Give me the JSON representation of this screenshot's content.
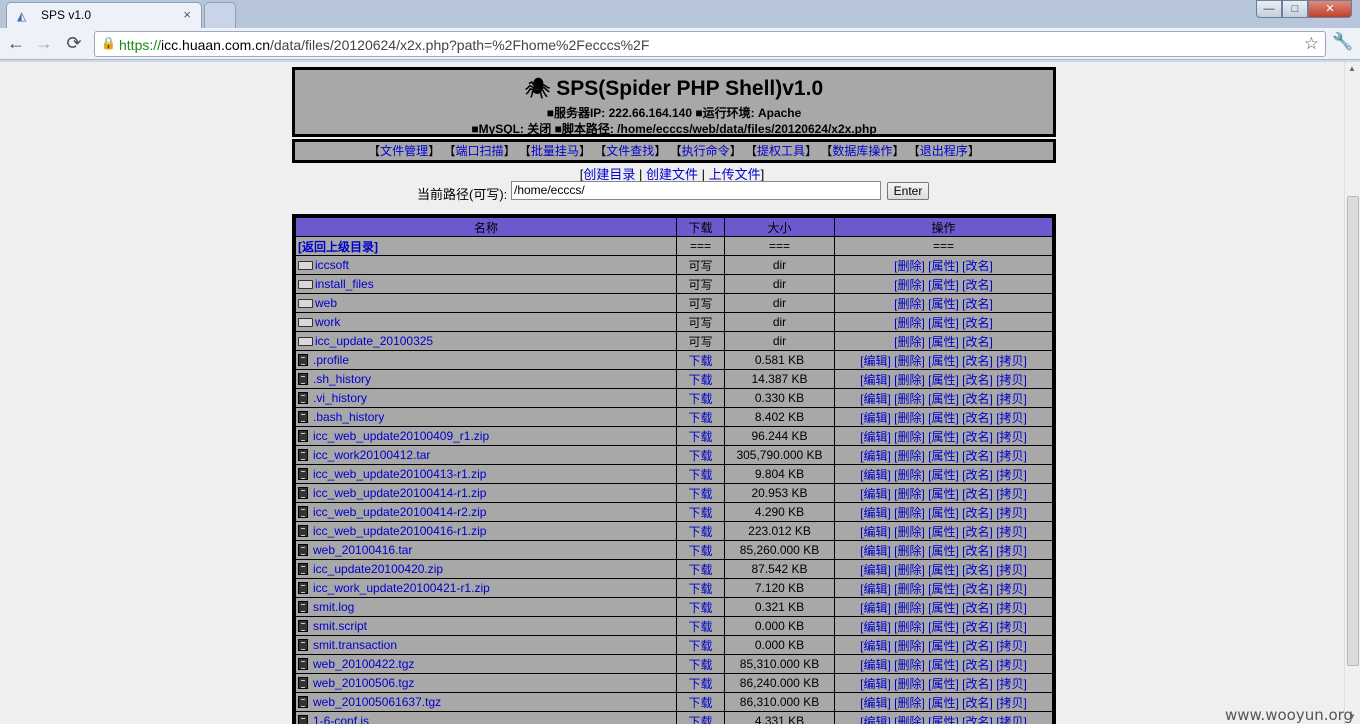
{
  "browser": {
    "tab_title": "SPS v1.0",
    "tab_close": "×",
    "url_scheme": "https",
    "url_host": "icc.huaan.com.cn",
    "url_path": "/data/files/20120624/x2x.php?path=%2Fhome%2Fecccs%2F",
    "back_icon": "←",
    "forward_icon": "→",
    "reload_icon": "⟳",
    "star_icon": "☆",
    "wrench_icon": "🔧",
    "min_label": "—",
    "max_label": "□",
    "close_label": "✕"
  },
  "header": {
    "title": "SPS(Spider PHP Shell)v1.0",
    "spider_glyph": "🕷",
    "info_line1": "■服务器IP: 222.66.164.140 ■运行环境: Apache",
    "info_line2": "■MySQL: 关闭 ■脚本路径: /home/ecccs/web/data/files/20120624/x2x.php"
  },
  "menu": [
    {
      "label": "文件管理"
    },
    {
      "label": "端口扫描"
    },
    {
      "label": "批量挂马"
    },
    {
      "label": "文件查找"
    },
    {
      "label": "执行命令"
    },
    {
      "label": "提权工具"
    },
    {
      "label": "数据库操作"
    },
    {
      "label": "退出程序"
    }
  ],
  "actions": {
    "mkdir": "创建目录",
    "newfile": "创建文件",
    "upload": "上传文件"
  },
  "path": {
    "label": "当前路径(可写):",
    "value": "/home/ecccs/",
    "enter": "Enter"
  },
  "table": {
    "headers": [
      "名称",
      "下载",
      "大小",
      "操作"
    ],
    "parent_row": {
      "name": "[返回上级目录]",
      "c2": "===",
      "c3": "===",
      "c4": "==="
    },
    "dir_rows": [
      {
        "name": "iccsoft",
        "perm": "可写",
        "size": "dir"
      },
      {
        "name": "install_files",
        "perm": "可写",
        "size": "dir"
      },
      {
        "name": "web",
        "perm": "可写",
        "size": "dir"
      },
      {
        "name": "work",
        "perm": "可写",
        "size": "dir"
      },
      {
        "name": "icc_update_20100325",
        "perm": "可写",
        "size": "dir"
      }
    ],
    "dir_ops": [
      "[删除]",
      "[属性]",
      "[改名]"
    ],
    "file_rows": [
      {
        "name": ".profile",
        "size": "0.581 KB"
      },
      {
        "name": ".sh_history",
        "size": "14.387 KB"
      },
      {
        "name": ".vi_history",
        "size": "0.330 KB"
      },
      {
        "name": ".bash_history",
        "size": "8.402 KB"
      },
      {
        "name": "icc_web_update20100409_r1.zip",
        "size": "96.244 KB"
      },
      {
        "name": "icc_work20100412.tar",
        "size": "305,790.000 KB"
      },
      {
        "name": "icc_web_update20100413-r1.zip",
        "size": "9.804 KB"
      },
      {
        "name": "icc_web_update20100414-r1.zip",
        "size": "20.953 KB"
      },
      {
        "name": "icc_web_update20100414-r2.zip",
        "size": "4.290 KB"
      },
      {
        "name": "icc_web_update20100416-r1.zip",
        "size": "223.012 KB"
      },
      {
        "name": "web_20100416.tar",
        "size": "85,260.000 KB"
      },
      {
        "name": "icc_update20100420.zip",
        "size": "87.542 KB"
      },
      {
        "name": "icc_work_update20100421-r1.zip",
        "size": "7.120 KB"
      },
      {
        "name": "smit.log",
        "size": "0.321 KB"
      },
      {
        "name": "smit.script",
        "size": "0.000 KB"
      },
      {
        "name": "smit.transaction",
        "size": "0.000 KB"
      },
      {
        "name": "web_20100422.tgz",
        "size": "85,310.000 KB"
      },
      {
        "name": "web_20100506.tgz",
        "size": "86,240.000 KB"
      },
      {
        "name": "web_201005061637.tgz",
        "size": "86,310.000 KB"
      },
      {
        "name": "1-6-conf.js",
        "size": "4.331 KB"
      }
    ],
    "download_label": "下载",
    "file_ops": [
      "[编辑]",
      "[删除]",
      "[属性]",
      "[改名]",
      "[拷贝]"
    ]
  },
  "watermark": "www.wooyun.org"
}
